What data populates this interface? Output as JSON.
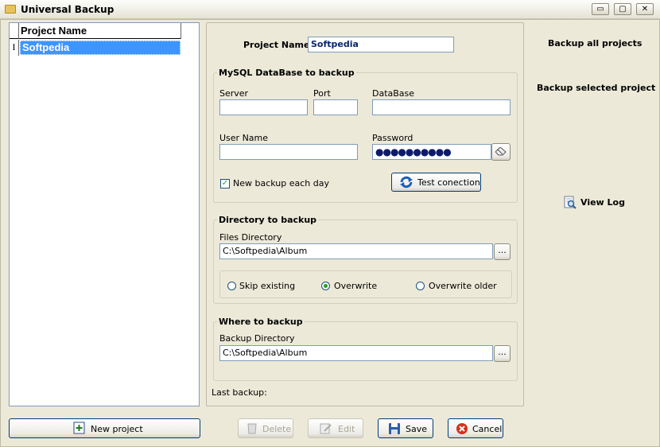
{
  "window": {
    "title": "Universal Backup",
    "minimize": "▭",
    "maximize": "▢",
    "close": "✕"
  },
  "project_list": {
    "column_header": "Project Name",
    "row_marker": "I",
    "items": [
      {
        "name": "Softpedia",
        "selected": true
      }
    ]
  },
  "editor": {
    "project_name_label": "Project Name",
    "project_name_value": "Softpedia",
    "mysql": {
      "legend": "MySQL DataBase to backup",
      "server_label": "Server",
      "server_value": "",
      "port_label": "Port",
      "port_value": "",
      "database_label": "DataBase",
      "database_value": "",
      "user_label": "User Name",
      "user_value": "",
      "password_label": "Password",
      "password_value": "●●●●●●●●●●",
      "new_backup_label": "New backup each day",
      "new_backup_checked": true,
      "test_button": "Test conection"
    },
    "directory": {
      "legend": "Directory to backup",
      "files_label": "Files Directory",
      "files_value": "C:\\Softpedia\\Album",
      "browse": "...",
      "options": [
        {
          "label": "Skip existing",
          "selected": false
        },
        {
          "label": "Overwrite",
          "selected": true
        },
        {
          "label": "Overwrite older",
          "selected": false
        }
      ]
    },
    "where": {
      "legend": "Where to backup",
      "backup_label": "Backup Directory",
      "backup_value": "C:\\Softpedia\\Album",
      "browse": "..."
    },
    "last_backup_label": "Last backup:"
  },
  "side": {
    "backup_all": "Backup all projects",
    "backup_selected": "Backup selected project",
    "view_log": "View Log"
  },
  "buttons": {
    "new_project": "New project",
    "delete": "Delete",
    "edit": "Edit",
    "save": "Save",
    "cancel": "Cancel"
  }
}
